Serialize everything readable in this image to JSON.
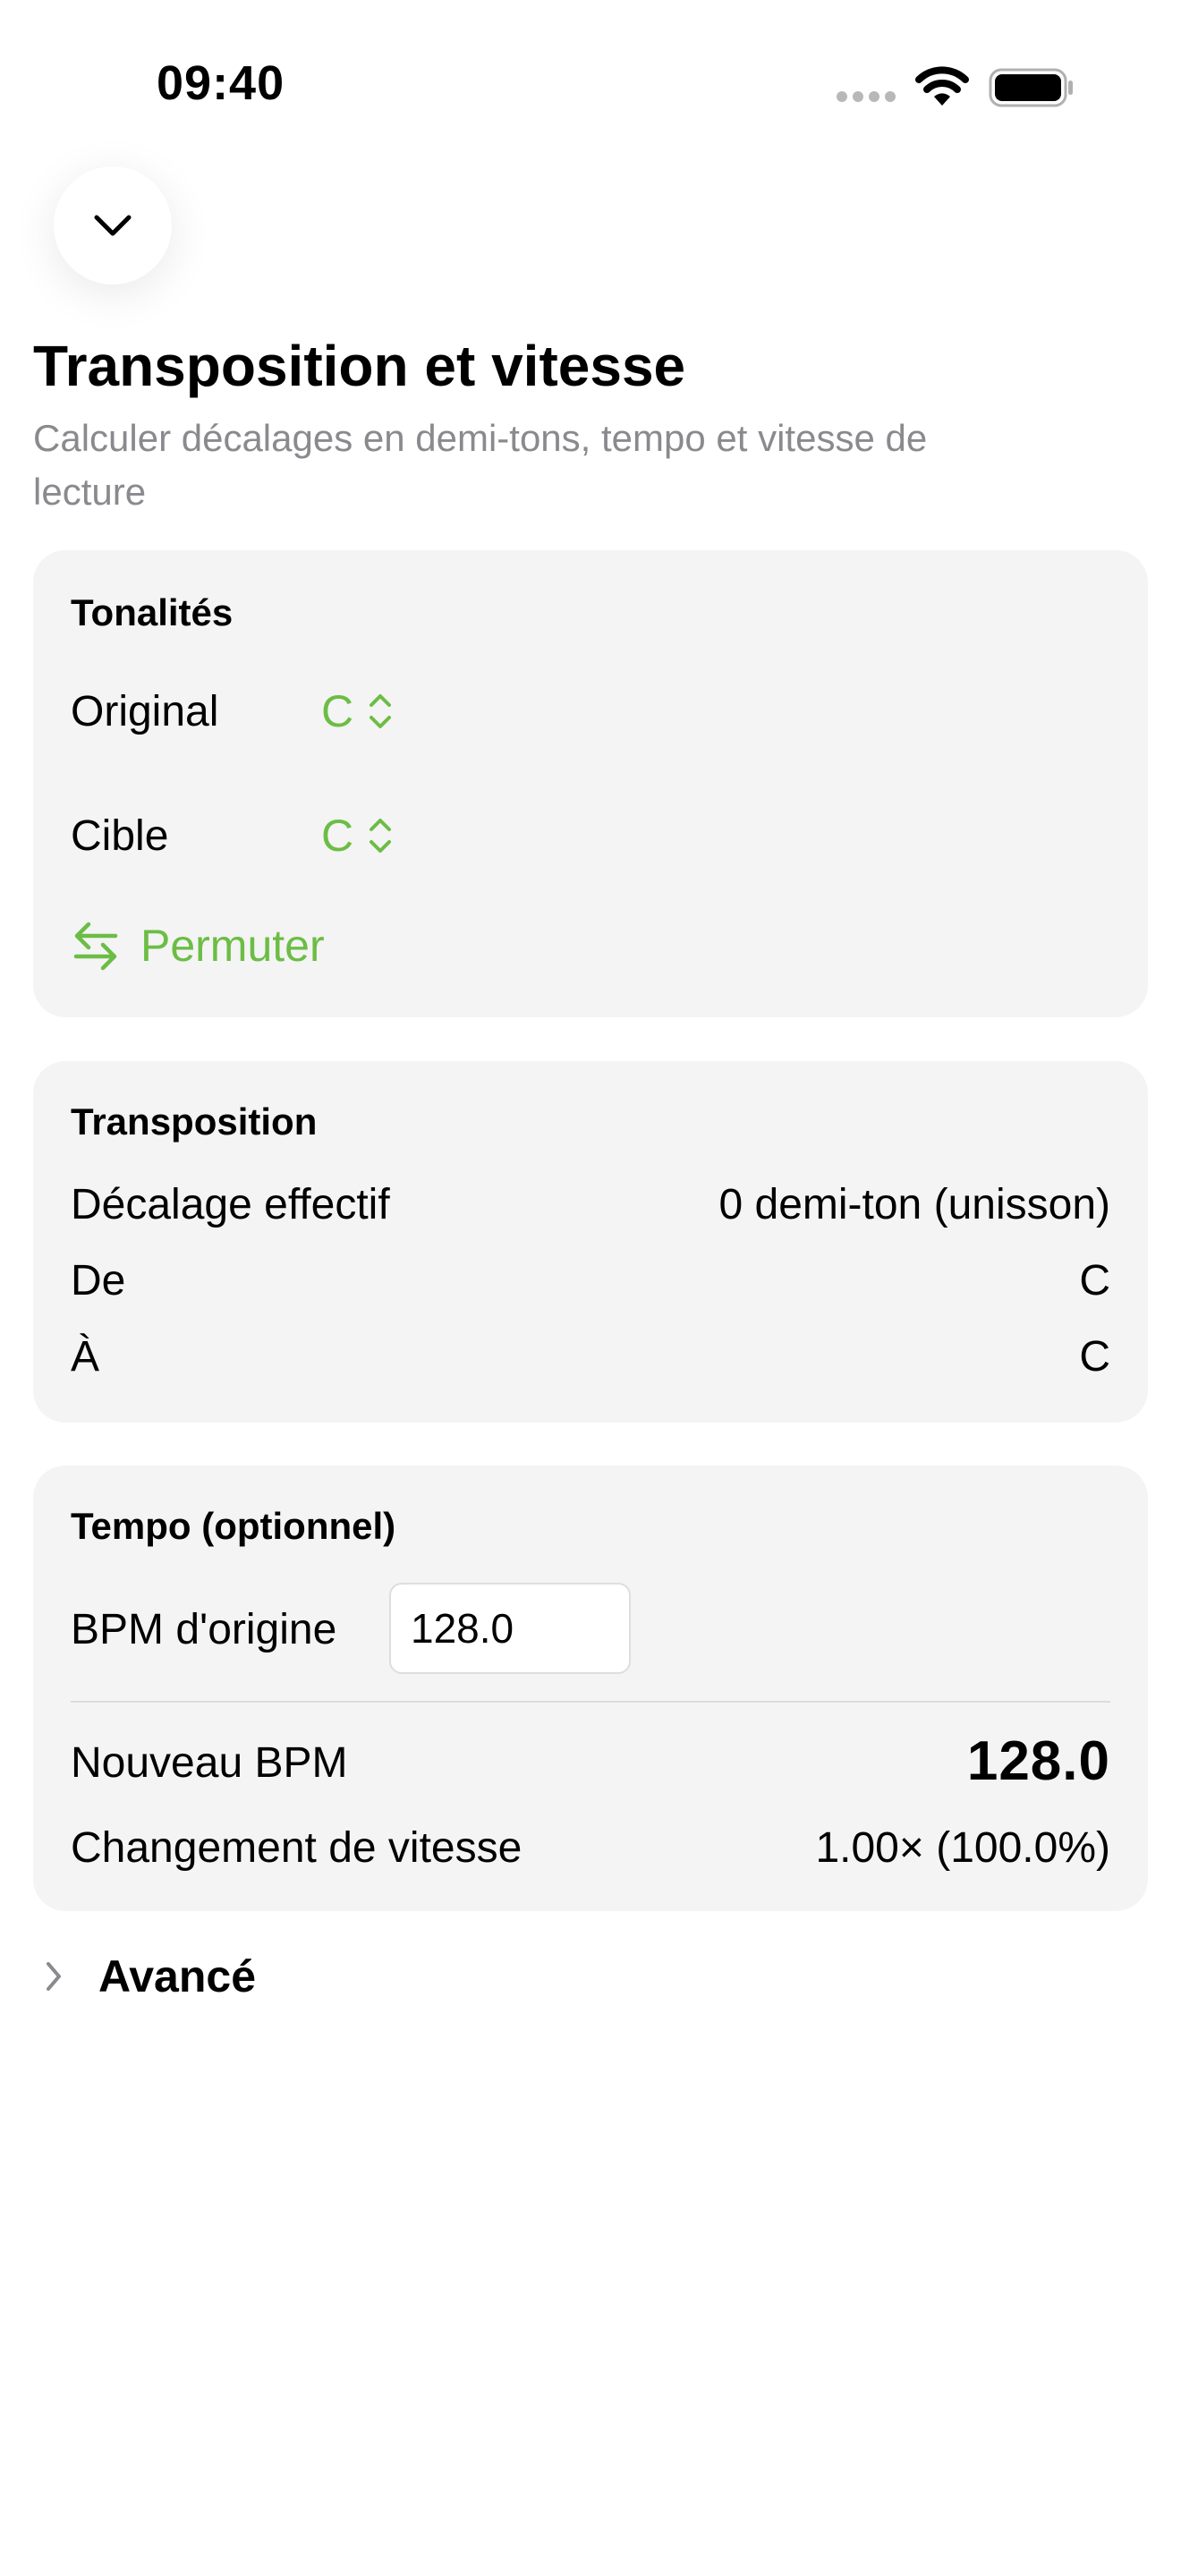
{
  "status_bar": {
    "time": "09:40"
  },
  "header": {
    "title": "Transposition et vitesse",
    "subtitle": "Calculer décalages en demi-tons, tempo et vitesse de lecture"
  },
  "keys_card": {
    "heading": "Tonalités",
    "original_label": "Original",
    "original_value": "C",
    "target_label": "Cible",
    "target_value": "C",
    "swap_label": "Permuter"
  },
  "transposition_card": {
    "heading": "Transposition",
    "rows": [
      {
        "label": "Décalage effectif",
        "value": "0 demi-ton (unisson)"
      },
      {
        "label": "De",
        "value": "C"
      },
      {
        "label": "À",
        "value": "C"
      }
    ]
  },
  "tempo_card": {
    "heading": "Tempo (optionnel)",
    "bpm_label": "BPM d'origine",
    "bpm_value": "128.0",
    "new_bpm_label": "Nouveau BPM",
    "new_bpm_value": "128.0",
    "speed_label": "Changement de vitesse",
    "speed_value": "1.00× (100.0%)"
  },
  "advanced": {
    "label": "Avancé"
  },
  "colors": {
    "accent": "#6cbd45",
    "card": "#f4f4f4",
    "secondary_text": "#8a8a8e"
  },
  "icons": [
    "chevron-down-icon",
    "swap-arrows-icon",
    "chevron-up-down-icon",
    "chevron-right-icon",
    "wifi-icon",
    "battery-icon"
  ]
}
